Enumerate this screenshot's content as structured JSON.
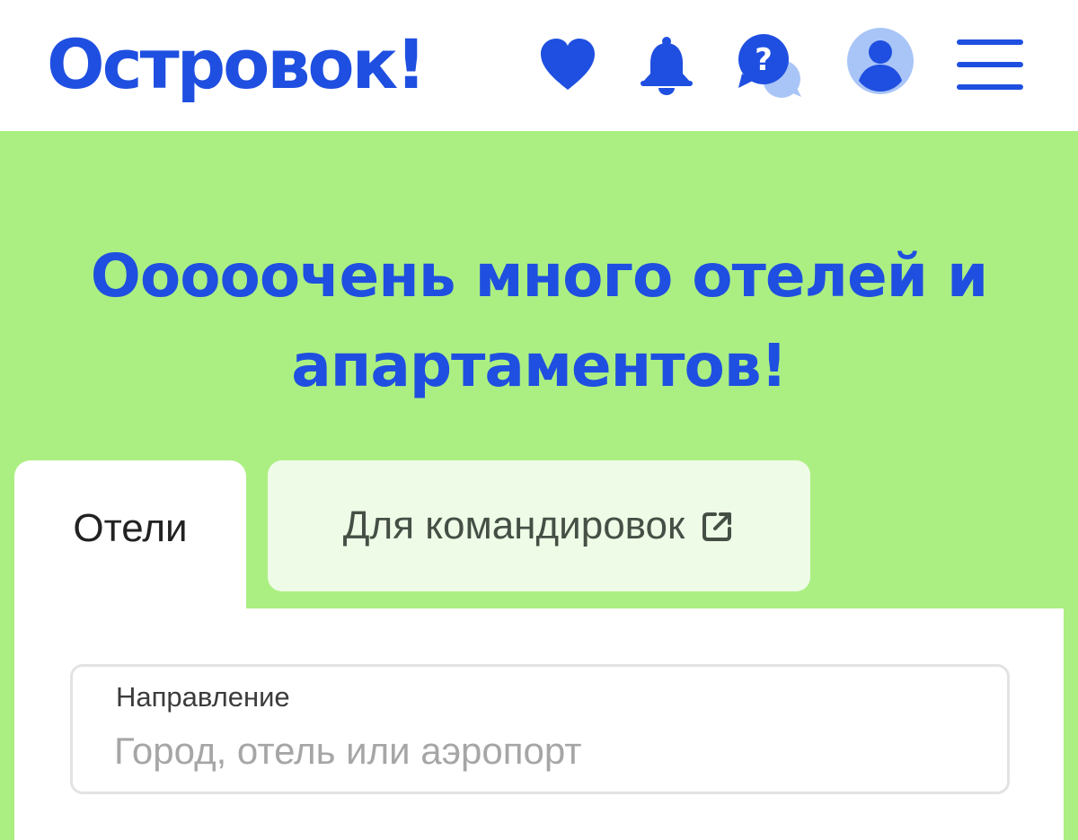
{
  "header": {
    "logo": "Островок!",
    "icons": [
      "heart-icon",
      "bell-icon",
      "help-chat-icon",
      "avatar-icon",
      "menu-icon"
    ]
  },
  "hero": {
    "title": "Ооооочень много отелей и апартаментов!"
  },
  "tabs": [
    {
      "label": "Отели",
      "active": true
    },
    {
      "label": "Для командировок",
      "icon": "external-link-icon",
      "active": false
    }
  ],
  "search": {
    "label": "Направление",
    "value": "",
    "placeholder": "Город, отель или аэропорт"
  },
  "colors": {
    "brand_blue": "#1f4fe0",
    "hero_green": "#abef82",
    "inactive_tab": "#eefbe6",
    "avatar_bg": "#a9c5f7"
  }
}
